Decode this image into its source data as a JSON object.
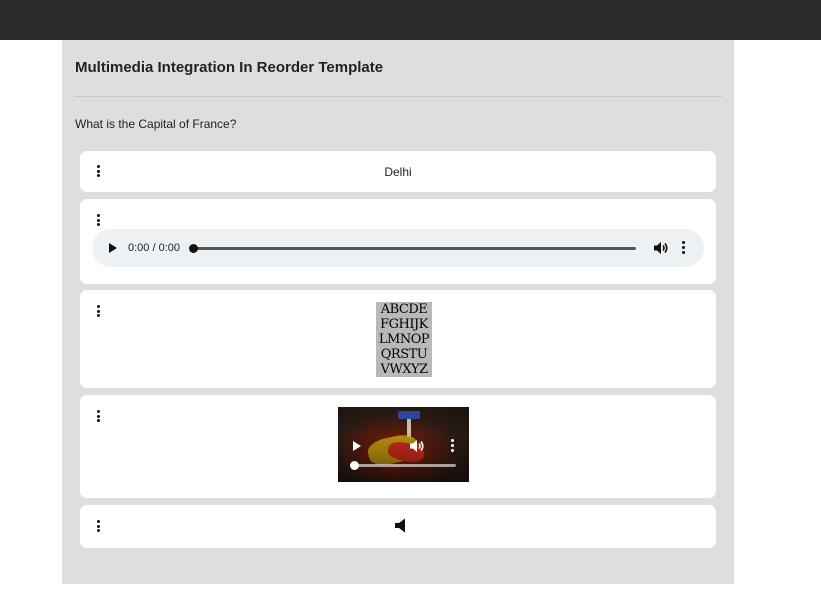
{
  "window": {
    "topbar": ""
  },
  "page": {
    "title": "Multimedia Integration In Reorder Template",
    "question": "What is the Capital of France?"
  },
  "options": [
    {
      "type": "text",
      "label": "Delhi"
    },
    {
      "type": "audio",
      "time": "0:00 / 0:00",
      "progress": 0
    },
    {
      "type": "image",
      "icon": "alphabet-image",
      "rows": [
        "ABCDE",
        "FGHIJK",
        "LMNOP",
        "QRSTU",
        "VWXYZ"
      ]
    },
    {
      "type": "video",
      "icon": "video-thumbnail",
      "progress": 0
    },
    {
      "type": "audio-icon",
      "icon": "speaker-icon"
    }
  ],
  "colors": {
    "topbar": "#2b2c2e",
    "panel": "#dedede",
    "card": "#ffffff",
    "audio_bg": "#eef1f3"
  }
}
